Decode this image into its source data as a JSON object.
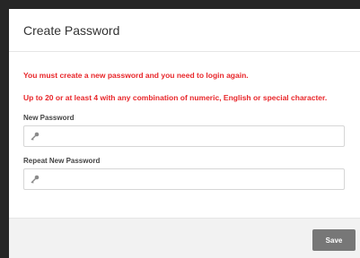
{
  "dialog": {
    "title": "Create Password",
    "warning_login": "You must create a new password and you need to login again.",
    "warning_rules": "Up to 20 or at least 4 with any combination of numeric, English or special character."
  },
  "fields": {
    "new_password": {
      "label": "New Password",
      "value": "",
      "icon": "key-icon"
    },
    "repeat_password": {
      "label": "Repeat New Password",
      "value": "",
      "icon": "key-icon"
    }
  },
  "footer": {
    "save_label": "Save"
  },
  "colors": {
    "warning": "#e8262a",
    "save_button": "#777777",
    "footer_bg": "#f2f2f2"
  }
}
